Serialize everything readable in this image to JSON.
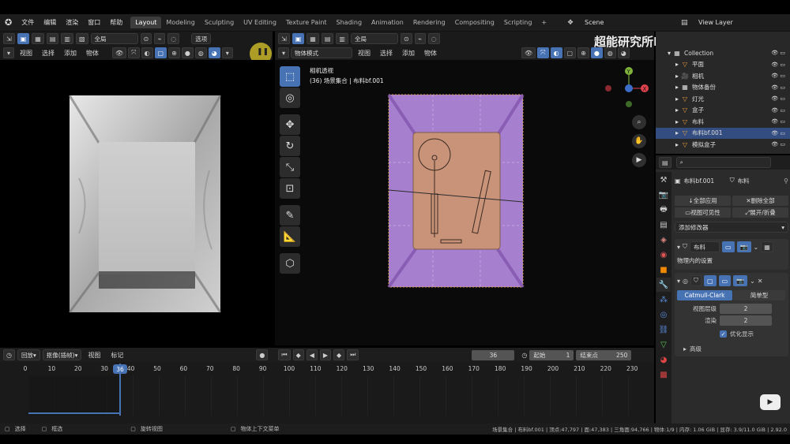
{
  "topbar": {
    "menus": [
      "文件",
      "编辑",
      "渲染",
      "窗口",
      "帮助"
    ],
    "tabs": [
      "Layout",
      "Modeling",
      "Sculpting",
      "UV Editing",
      "Texture Paint",
      "Shading",
      "Animation",
      "Rendering",
      "Compositing",
      "Scripting"
    ],
    "active_tab": "Layout",
    "scene": "Scene",
    "view_layer": "View Layer"
  },
  "left_header": {
    "orientation": "全局",
    "options": "选项",
    "menus": [
      "视图",
      "选择",
      "添加",
      "物体"
    ]
  },
  "right_header": {
    "orientation": "全局",
    "mode": "物体模式",
    "menus": [
      "视图",
      "选择",
      "添加",
      "物体"
    ]
  },
  "viewport": {
    "camera_label": "相机透视",
    "collection_label": "(36) 场景集合 | 布料bf.001"
  },
  "watermark": {
    "text": "超能研究所Design",
    "brand": "bilibili"
  },
  "outliner": {
    "items": [
      {
        "label": "Collection",
        "icon": "collection-icon",
        "selected": false
      },
      {
        "label": "平面",
        "icon": "mesh-icon",
        "selected": false
      },
      {
        "label": "相机",
        "icon": "camera-icon",
        "selected": false
      },
      {
        "label": "物体备份",
        "icon": "collection-icon",
        "selected": false
      },
      {
        "label": "灯光",
        "icon": "mesh-icon",
        "selected": false
      },
      {
        "label": "盒子",
        "icon": "mesh-icon",
        "selected": false
      },
      {
        "label": "布料",
        "icon": "mesh-icon",
        "selected": false
      },
      {
        "label": "布料bf.001",
        "icon": "mesh-icon",
        "selected": true
      },
      {
        "label": "模拟盒子",
        "icon": "mesh-icon",
        "selected": false
      }
    ]
  },
  "properties": {
    "object_name": "布料bf.001",
    "modifier_tab": "布料",
    "apply_all": "全部应用",
    "delete_all": "删除全部",
    "view_visibility": "视图可见性",
    "expand_collapse": "展开/折叠",
    "add_modifier": "添加修改器",
    "cloth_modifier": "布料",
    "physics_note": "物理内的设置",
    "subdiv_types": [
      "Catmull-Clark",
      "简单型"
    ],
    "viewport_levels_label": "视图层级",
    "viewport_levels": "2",
    "render_label": "渲染",
    "render_levels": "2",
    "optimize_label": "优化显示",
    "advanced_label": "高级"
  },
  "timeline": {
    "menus": [
      "回放",
      "抠像(插帧)",
      "视图",
      "标记"
    ],
    "current_frame": "36",
    "start_label": "起始",
    "start": "1",
    "end_label": "结束点",
    "end": "250",
    "ticks": [
      "0",
      "10",
      "20",
      "30",
      "40",
      "50",
      "60",
      "70",
      "80",
      "90",
      "100",
      "110",
      "120",
      "130",
      "140",
      "150",
      "160",
      "170",
      "180",
      "190",
      "200",
      "210",
      "220",
      "230"
    ]
  },
  "status": {
    "items": [
      "选择",
      "框选",
      "旋转视图",
      "物体上下文菜单"
    ],
    "stats": "场景集合 | 布料bf.001 | 顶点:47,797 | 面:47,383 | 三角面:94,766 | 物体:1/9 | 内存: 1.06 GiB | 显存: 3.9/11.0 GiB | 2.92.0"
  },
  "colors": {
    "accent": "#4772b3",
    "cloth": "#a77fcf",
    "box": "#c9937a"
  }
}
